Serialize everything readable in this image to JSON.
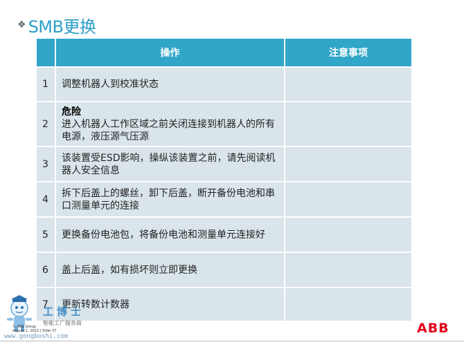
{
  "title": {
    "bullet": "❖",
    "text": "SMB更换"
  },
  "table": {
    "headers": [
      "",
      "操作",
      "注意事项"
    ],
    "rows": [
      {
        "num": "1",
        "danger": "",
        "text": "调整机器人到校准状态",
        "note": ""
      },
      {
        "num": "2",
        "danger": "危险",
        "text": "进入机器人工作区域之前关闭连接到机器人的所有电源，液压源气压源",
        "note": ""
      },
      {
        "num": "3",
        "danger": "",
        "text": "该装置受ESD影响，操纵该装置之前，请先阅读机器人安全信息",
        "note": ""
      },
      {
        "num": "4",
        "danger": "",
        "text": "拆下后盖上的螺丝，卸下后盖，断开备份电池和串口测量单元的连接",
        "note": ""
      },
      {
        "num": "5",
        "danger": "",
        "text": "更换备份电池包，将备份电池和测量单元连接好",
        "note": ""
      },
      {
        "num": "6",
        "danger": "",
        "text": "盖上后盖，如有损坏则立即更换",
        "note": ""
      },
      {
        "num": "7",
        "danger": "",
        "text": "更新转数计数器",
        "note": ""
      }
    ]
  },
  "footer": {
    "company": "© ABB Group",
    "date_slide": "August 1, 2012 | Slide 37",
    "logo": "ABB"
  },
  "watermark": {
    "name": "工博士",
    "subtitle": "智能工厂服务商",
    "url": "www.gongboshi.com"
  }
}
